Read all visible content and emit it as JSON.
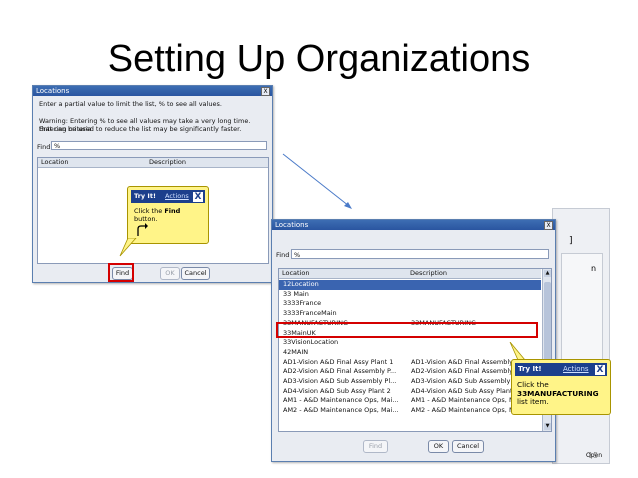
{
  "slide": {
    "title": "Setting Up Organizations",
    "page_number": "15"
  },
  "dialog1": {
    "title": "Locations",
    "close": "X",
    "instructions": "Enter a partial value to limit the list, % to see all values.",
    "warning1": "Warning: Entering % to see all values may take a very long time. Entering criteria",
    "warning2": "that can be used to reduce the list may be significantly faster.",
    "find_label": "Find",
    "find_value": "%",
    "col_location": "Location",
    "col_description": "Description",
    "btn_find": "Find",
    "btn_ok": "OK",
    "btn_cancel": "Cancel"
  },
  "callout1": {
    "header": "Try It!",
    "actions": "Actions",
    "close": "X",
    "line1": "Click the",
    "bold": "Find",
    "line2": "button."
  },
  "dialog2": {
    "title": "Locations",
    "close": "X",
    "find_label": "Find",
    "find_value": "%",
    "col_location": "Location",
    "col_description": "Description",
    "rows": [
      {
        "location": "12Location",
        "description": ""
      },
      {
        "location": "33 Main",
        "description": ""
      },
      {
        "location": "3333France",
        "description": ""
      },
      {
        "location": "3333FranceMain",
        "description": ""
      },
      {
        "location": "33MANUFACTURING",
        "description": "33MANUFACTURING"
      },
      {
        "location": "33MainUK",
        "description": ""
      },
      {
        "location": "33VisionLocation",
        "description": ""
      },
      {
        "location": "42MAIN",
        "description": ""
      },
      {
        "location": "AD1-Vision A&D Final Assy Plant 1",
        "description": "AD1-Vision A&D Final Assembly"
      },
      {
        "location": "AD2-Vision A&D Final Assembly P...",
        "description": "AD2-Vision A&D Final Assembly"
      },
      {
        "location": "AD3-Vision A&D Sub Assembly Pl...",
        "description": "AD3-Vision A&D Sub Assembly"
      },
      {
        "location": "AD4-Vision A&D Sub Assy Plant 2",
        "description": "AD4-Vision A&D Sub Assy Plant"
      },
      {
        "location": "AM1 - A&D Maintenance Ops, Mai...",
        "description": "AM1 - A&D Maintenance Ops, Mai..."
      },
      {
        "location": "AM2 - A&D Maintenance Ops, Mai...",
        "description": "AM2 - A&D Maintenance Ops, Mai..."
      }
    ],
    "btn_find": "Find",
    "btn_ok": "OK",
    "btn_cancel": "Cancel"
  },
  "callout2": {
    "header": "Try It!",
    "actions": "Actions",
    "close": "X",
    "line1": "Click the",
    "bold": "33MANUFACTURING",
    "line2": "list item."
  },
  "background_window": {
    "bracket": "]",
    "letter": "n",
    "button": "Open"
  },
  "colors": {
    "titlebar": "#2a55a0",
    "highlight": "#d40000",
    "callout": "#fff488",
    "selected_row": "#3a64b0"
  }
}
